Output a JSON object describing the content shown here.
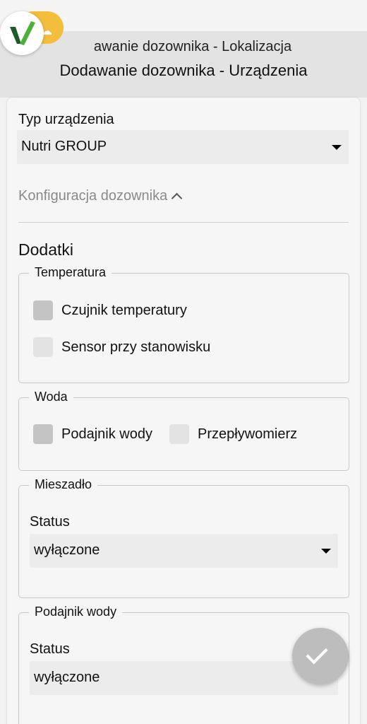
{
  "header": {
    "subtitle": "awanie dozownika - Lokalizacja",
    "title": "Dodawanie dozownika - Urządzenia"
  },
  "device": {
    "label": "Typ urządzenia",
    "value": "Nutri GROUP"
  },
  "config_toggle": "Konfiguracja dozownika",
  "extras": {
    "title": "Dodatki",
    "temperature": {
      "legend": "Temperatura",
      "options": [
        "Czujnik temperatury",
        "Sensor przy stanowisku"
      ]
    },
    "water": {
      "legend": "Woda",
      "options": [
        "Podajnik wody",
        "Przepływomierz"
      ]
    },
    "mixer": {
      "legend": "Mieszadło",
      "status_label": "Status",
      "status_value": "wyłączone"
    },
    "water_feeder": {
      "legend": "Podajnik wody",
      "status_label": "Status",
      "status_value": "wyłączone"
    }
  },
  "icons": {
    "logo": "app-logo-icon",
    "confirm": "check-icon"
  }
}
